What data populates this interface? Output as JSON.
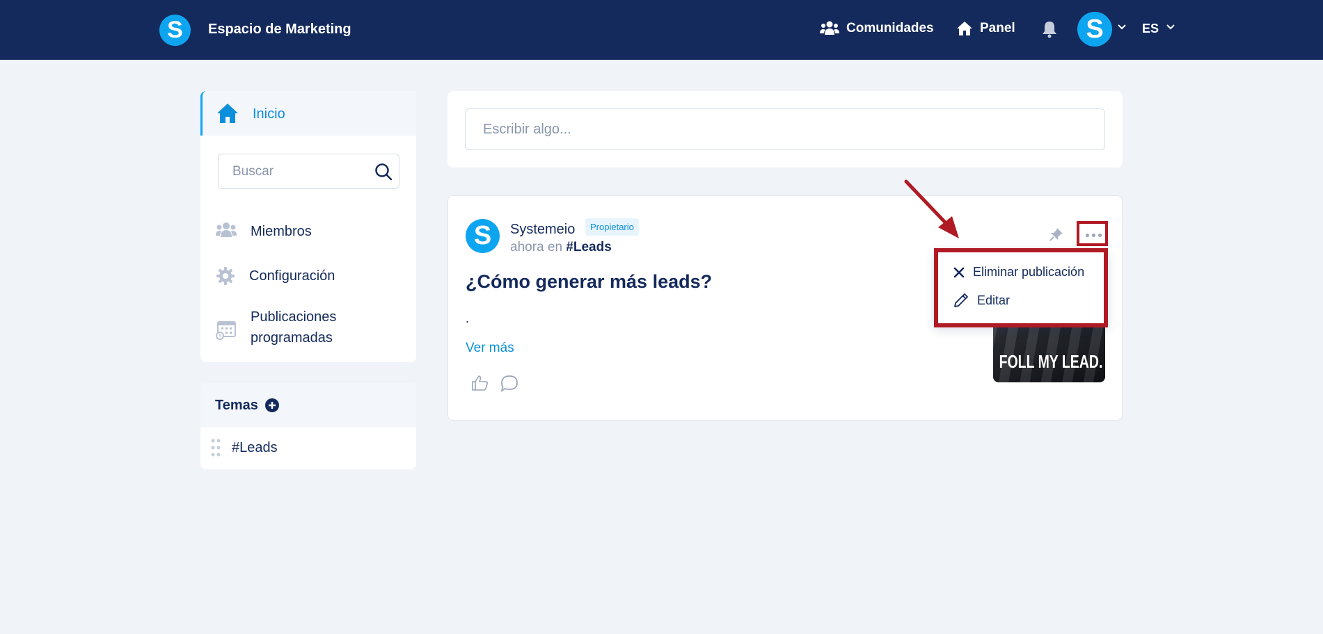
{
  "header": {
    "brand": "Espacio de Marketing",
    "logo_letter": "S",
    "nav_communities": "Comunidades",
    "nav_panel": "Panel",
    "avatar_letter": "S",
    "language": "ES"
  },
  "sidebar": {
    "home_label": "Inicio",
    "search_placeholder": "Buscar",
    "members_label": "Miembros",
    "config_label": "Configuración",
    "scheduled_label": "Publicaciones programadas",
    "topics_heading": "Temas",
    "topics": [
      "#Leads"
    ]
  },
  "composer": {
    "placeholder": "Escribir algo..."
  },
  "post": {
    "avatar_letter": "S",
    "author": "Systemeio",
    "badge": "Propietario",
    "time": "ahora en",
    "topic": "#Leads",
    "title": "¿Cómo generar más leads?",
    "body": ".",
    "see_more": "Ver más",
    "image_caption": "FOLL   MY LEAD."
  },
  "dropdown": {
    "delete_label": "Eliminar publicación",
    "edit_label": "Editar"
  },
  "colors": {
    "header_bg": "#142a5c",
    "accent": "#0ea5f0",
    "link": "#0b8fdb",
    "highlight": "#b01a24",
    "page_bg": "#f0f3f8"
  }
}
